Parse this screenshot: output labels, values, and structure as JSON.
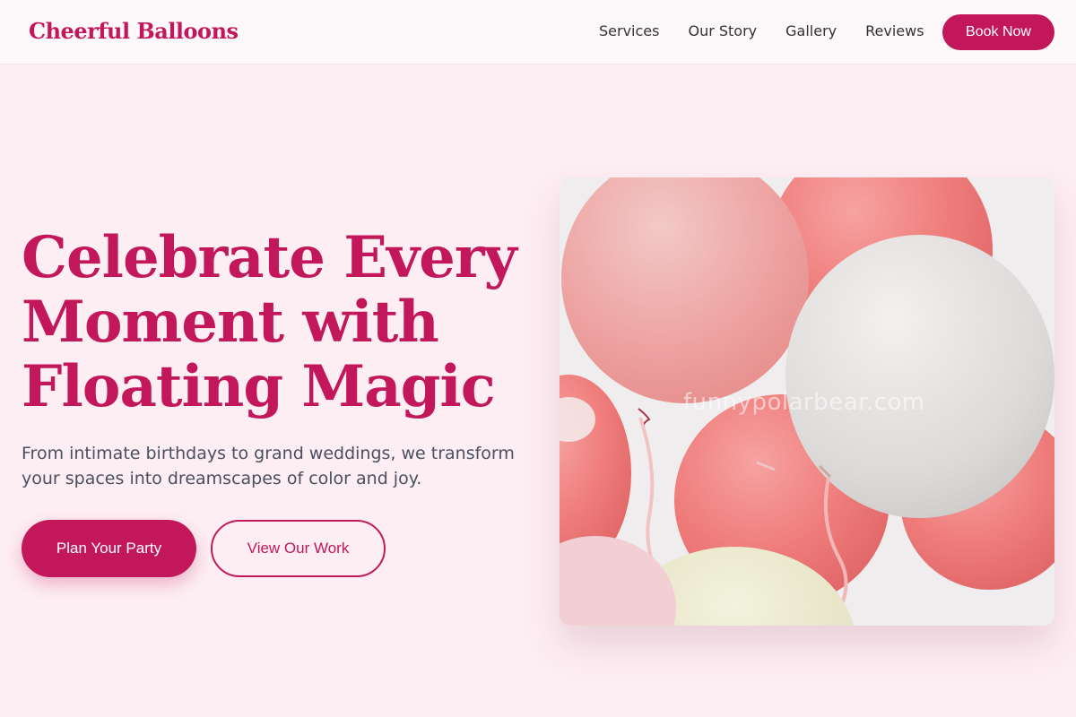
{
  "brand": {
    "name": "Cheerful Balloons"
  },
  "nav": {
    "links": [
      "Services",
      "Our Story",
      "Gallery",
      "Reviews"
    ],
    "cta": "Book Now"
  },
  "hero": {
    "title_lines": [
      "Celebrate Every",
      "Moment with",
      "Floating Magic"
    ],
    "subtitle": "From intimate birthdays to grand weddings, we transform your spaces into dreamscapes of color and joy.",
    "primary_button": "Plan Your Party",
    "secondary_button": "View Our Work",
    "image": {
      "subject": "pink-white-balloons-photo",
      "watermark": "funnypolarbear.com"
    }
  },
  "colors": {
    "accent": "#c2185b",
    "background": "#fdeef3",
    "nav_background": "#fdf8f9",
    "text": "#333333",
    "subtext": "#4a5060"
  }
}
